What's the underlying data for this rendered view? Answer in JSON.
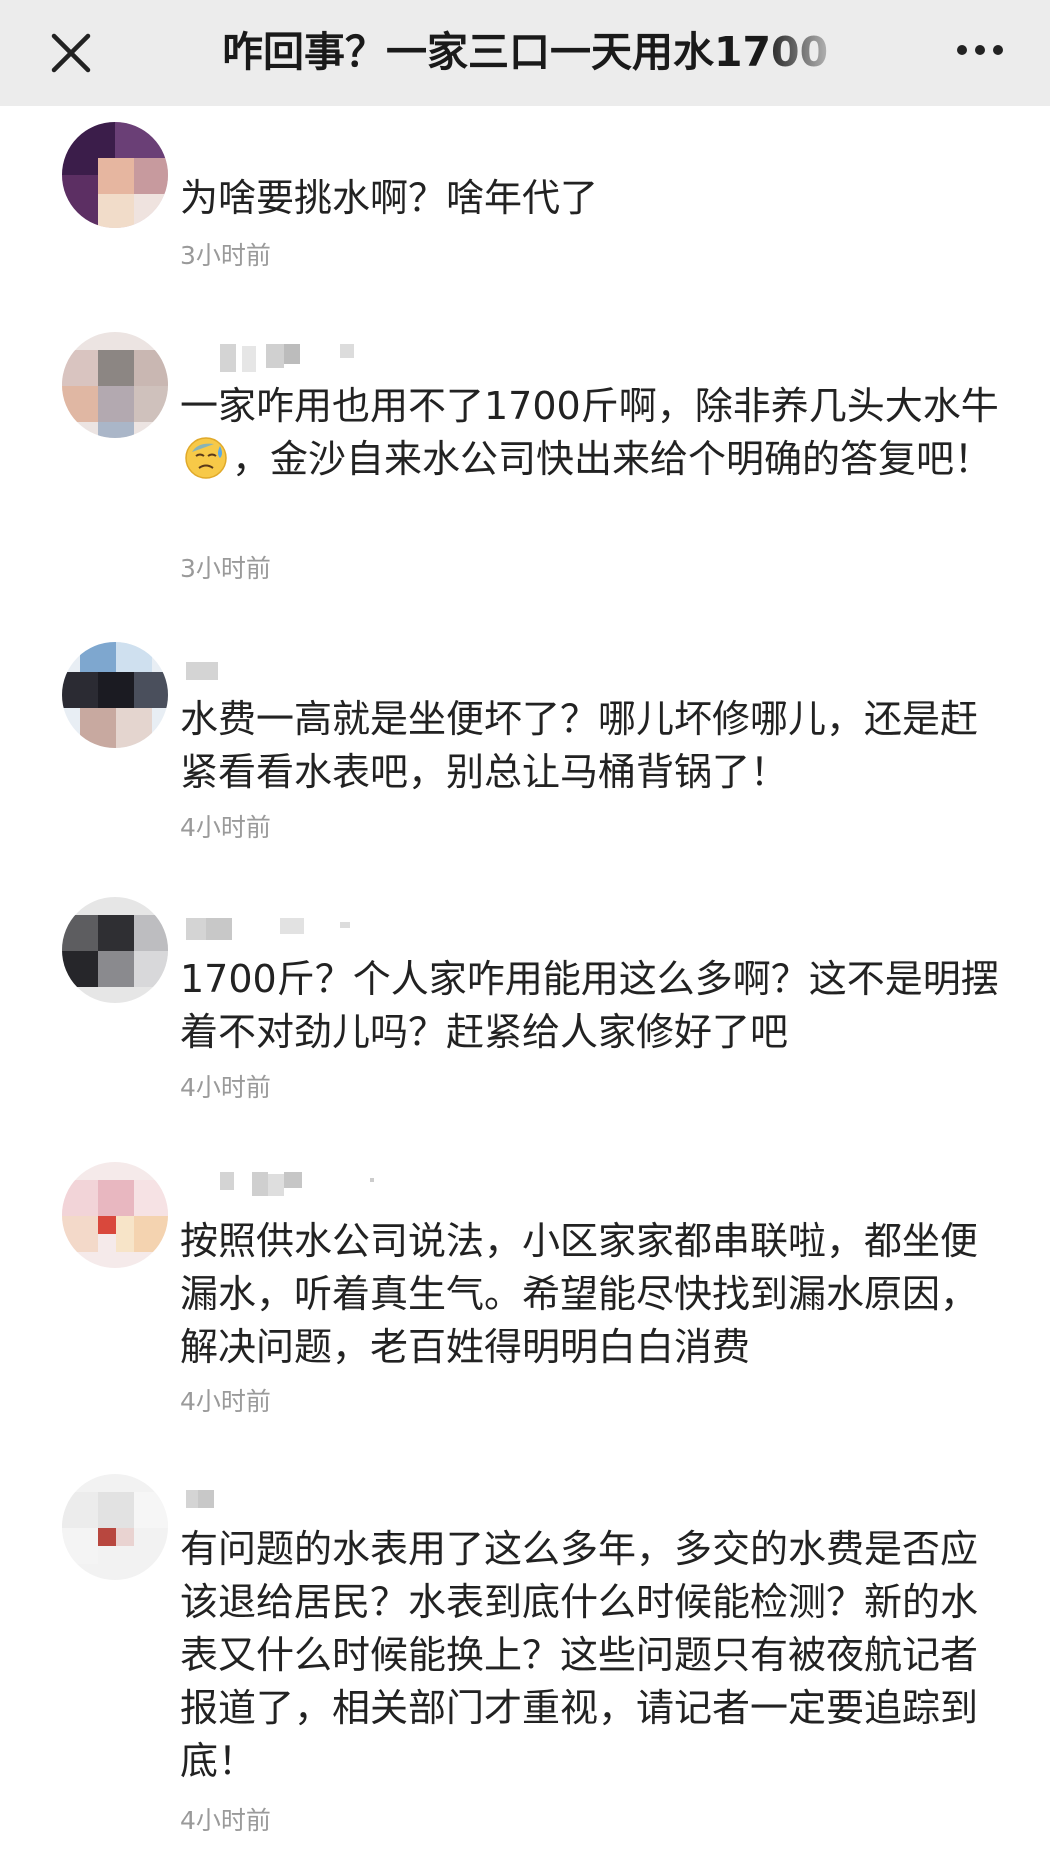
{
  "header": {
    "title": "咋回事？一家三口一天用水1700"
  },
  "comments": [
    {
      "text": "为啥要挑水啊？啥年代了",
      "time": "3小时前"
    },
    {
      "text_before_emoji": "一家咋用也用不了1700斤啊，除非养几头大水牛",
      "emoji": "sweat-face-emoji",
      "text_after_emoji": "，金沙自来水公司快出来给个明确的答复吧！",
      "time": "3小时前"
    },
    {
      "text": "水费一高就是坐便坏了？哪儿坏修哪儿，还是赶紧看看水表吧，别总让马桶背锅了！",
      "time": "4小时前"
    },
    {
      "text": "1700斤？个人家咋用能用这么多啊？这不是明摆着不对劲儿吗？赶紧给人家修好了吧",
      "time": "4小时前"
    },
    {
      "text": "按照供水公司说法，小区家家都串联啦，都坐便漏水，听着真生气。希望能尽快找到漏水原因，解决问题，老百姓得明明白白消费",
      "time": "4小时前"
    },
    {
      "text": "有问题的水表用了这么多年，多交的水费是否应该退给居民？水表到底什么时候能检测？新的水表又什么时候能换上？这些问题只有被夜航记者报道了，相关部门才重视，请记者一定要追踪到底！",
      "time": "4小时前"
    }
  ],
  "icons": {
    "close": "close-icon",
    "more": "more-icon"
  }
}
